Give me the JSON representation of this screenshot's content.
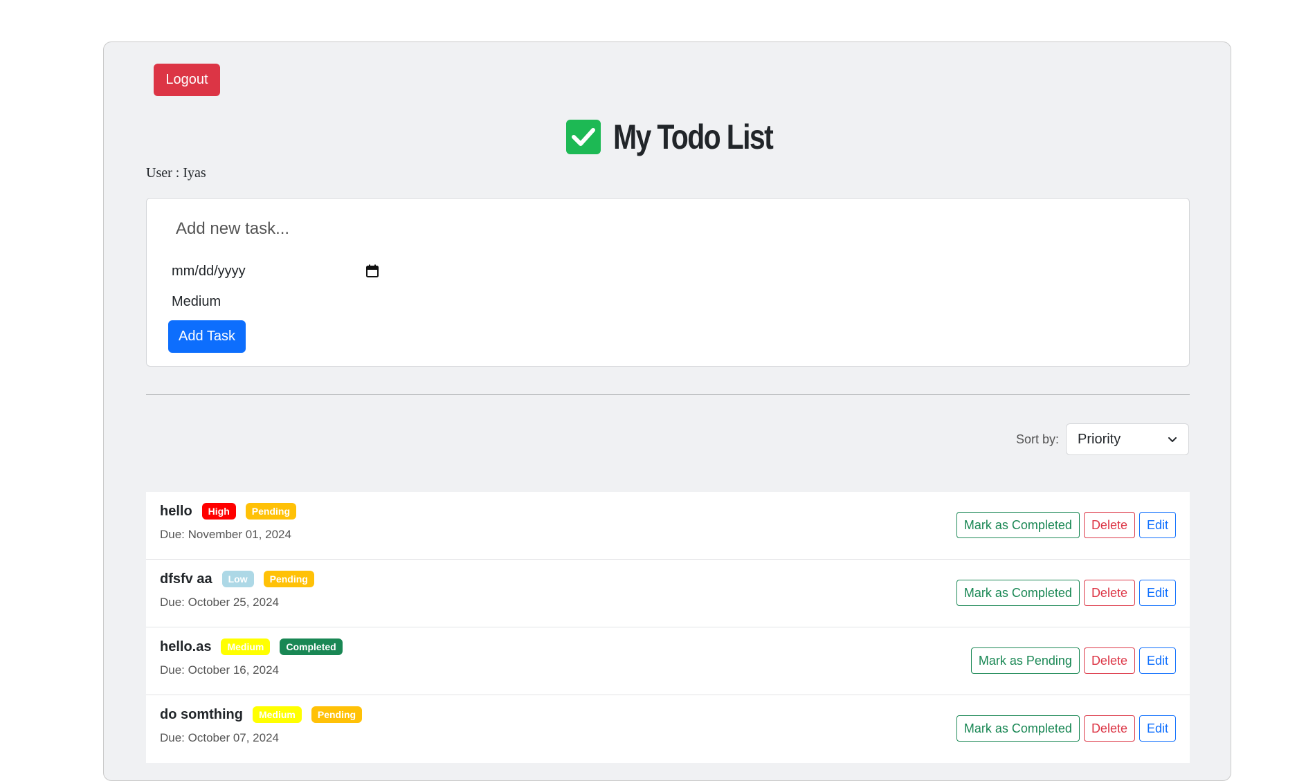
{
  "header": {
    "logout_label": "Logout",
    "title": "My Todo List",
    "user_label": "User : Iyas"
  },
  "form": {
    "task_placeholder": "Add new task...",
    "date_placeholder": "mm/dd/yyyy",
    "priority_value": "Medium",
    "add_label": "Add Task"
  },
  "sort": {
    "label": "Sort by:",
    "value": "Priority"
  },
  "colors": {
    "high": "#ff0000",
    "low": "#add8e6",
    "medium": "#ffff00",
    "pending": "#ffc107",
    "completed": "#198754"
  },
  "tasks": [
    {
      "name": "hello",
      "priority": "High",
      "status": "Pending",
      "due": "Due: November 01, 2024",
      "toggle_label": "Mark as Completed",
      "delete_label": "Delete",
      "edit_label": "Edit"
    },
    {
      "name": "dfsfv aa",
      "priority": "Low",
      "status": "Pending",
      "due": "Due: October 25, 2024",
      "toggle_label": "Mark as Completed",
      "delete_label": "Delete",
      "edit_label": "Edit"
    },
    {
      "name": "hello.as",
      "priority": "Medium",
      "status": "Completed",
      "due": "Due: October 16, 2024",
      "toggle_label": "Mark as Pending",
      "delete_label": "Delete",
      "edit_label": "Edit"
    },
    {
      "name": "do somthing",
      "priority": "Medium",
      "status": "Pending",
      "due": "Due: October 07, 2024",
      "toggle_label": "Mark as Completed",
      "delete_label": "Delete",
      "edit_label": "Edit"
    }
  ]
}
